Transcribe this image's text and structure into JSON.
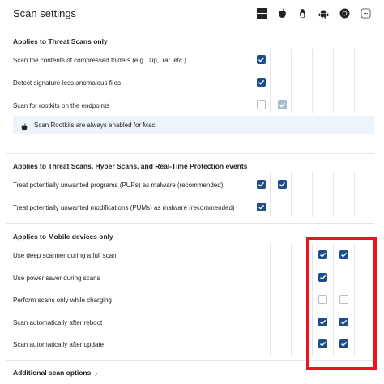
{
  "title": "Scan settings",
  "os_icons": [
    "windows-icon",
    "apple-icon",
    "linux-icon",
    "android-icon",
    "chrome-icon",
    "chromebook-icon"
  ],
  "sections": [
    {
      "heading": "Applies to Threat Scans only",
      "rows": [
        {
          "label": "Scan the contents of compressed folders (e.g. .zip, .rar. etc.)",
          "windows": "checked"
        },
        {
          "label": "Detect signature-less anomalous files",
          "windows": "checked"
        },
        {
          "label": "Scan for rootkits on the endpoints",
          "windows": "unchecked",
          "mac": "checked-disabled"
        }
      ],
      "info": "Scan Rootkits are always enabled for Mac"
    },
    {
      "heading": "Applies to Threat Scans, Hyper Scans, and Real-Time Protection events",
      "rows": [
        {
          "label": "Treat potentially unwanted programs (PUPs) as malware (recommended)",
          "windows": "checked",
          "mac": "checked"
        },
        {
          "label": "Treat potentially unwanted modifications (PUMs) as malware (recommended)",
          "windows": "checked"
        }
      ]
    },
    {
      "heading": "Applies to Mobile devices only",
      "rows": [
        {
          "label": "Use deep scanner during a full scan",
          "android": "checked",
          "chrome": "checked"
        },
        {
          "label": "Use power saver during scans",
          "android": "checked"
        },
        {
          "label": "Perform scans only while charging",
          "android": "unchecked",
          "chrome": "unchecked"
        },
        {
          "label": "Scan automatically after reboot",
          "android": "checked",
          "chrome": "checked"
        },
        {
          "label": "Scan automatically after update",
          "android": "checked",
          "chrome": "checked"
        }
      ]
    }
  ],
  "more": "Additional scan options",
  "colors": {
    "checked": "#1d4e89",
    "highlight": "#f20f1e",
    "info_bg": "#eef4fb"
  }
}
